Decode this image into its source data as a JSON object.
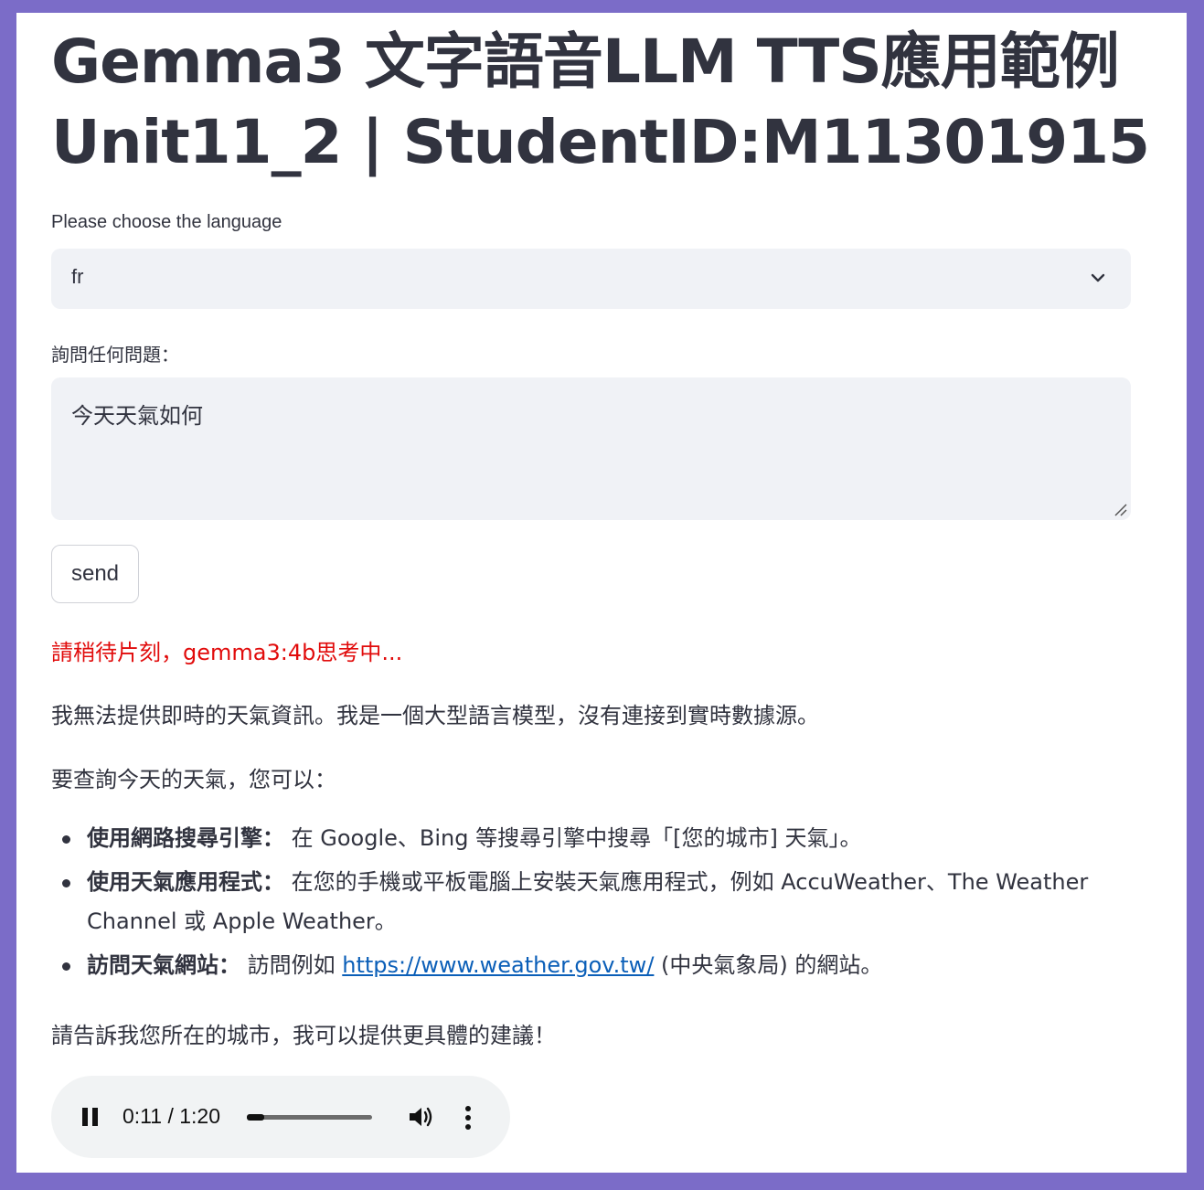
{
  "title": {
    "line1": "Gemma3 文字語音LLM TTS應用範例",
    "line2": "Unit11_2 | StudentID:M11301915"
  },
  "language_select": {
    "label": "Please choose the language",
    "value": "fr"
  },
  "question": {
    "label": "詢問任何問題：",
    "value": "今天天氣如何"
  },
  "send_button": {
    "label": "send"
  },
  "status_text": "請稍待片刻，gemma3:4b思考中...",
  "response": {
    "para1": "我無法提供即時的天氣資訊。我是一個大型語言模型，沒有連接到實時數據源。",
    "para2": "要查詢今天的天氣，您可以：",
    "bullets": [
      {
        "bold": "使用網路搜尋引擎：",
        "text": " 在 Google、Bing 等搜尋引擎中搜尋「[您的城市] 天氣」。"
      },
      {
        "bold": "使用天氣應用程式：",
        "text": " 在您的手機或平板電腦上安裝天氣應用程式，例如 AccuWeather、The Weather Channel 或 Apple Weather。"
      },
      {
        "bold": "訪問天氣網站：",
        "text_before": " 訪問例如 ",
        "link": "https://www.weather.gov.tw/",
        "text_after": " (中央氣象局) 的網站。"
      }
    ],
    "para3": "請告訴我您所在的城市，我可以提供更具體的建議！"
  },
  "audio_player": {
    "time_display": "0:11 / 1:20",
    "progress": 0.1375,
    "icons": [
      "pause-icon",
      "volume-icon",
      "more-options-icon"
    ]
  },
  "colors": {
    "background": "#7b6cc8",
    "status": "#e10b0b",
    "link": "#0b5fb8",
    "input_bg": "#f0f2f6"
  }
}
